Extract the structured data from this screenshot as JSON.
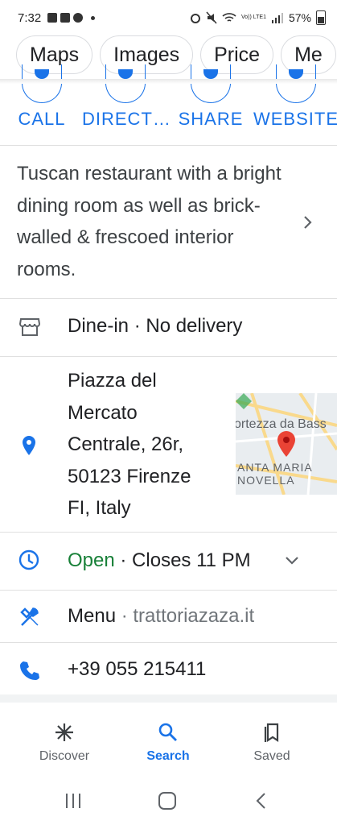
{
  "status": {
    "time": "7:32",
    "network": "Vo)) LTE1",
    "battery": "57%"
  },
  "chips": [
    "Maps",
    "Images",
    "Price",
    "Me"
  ],
  "actions": [
    {
      "label": "CALL"
    },
    {
      "label": "DIRECT…"
    },
    {
      "label": "SHARE"
    },
    {
      "label": "WEBSITE"
    }
  ],
  "description": "Tuscan restaurant with a bright dining room as well as brick-walled & frescoed interior rooms.",
  "service": {
    "text": "Dine-in · No delivery"
  },
  "address": {
    "line1": "Piazza del",
    "line2": "Mercato",
    "line3": "Centrale, 26r,",
    "line4": "50123 Firenze",
    "line5": "FI, Italy",
    "map_label_1": "ortezza da Bass",
    "map_label_2a": "ANTA MARIA",
    "map_label_2b": "NOVELLA"
  },
  "hours": {
    "status": "Open",
    "closes": "· Closes 11 PM"
  },
  "menu": {
    "label": "Menu",
    "separator": "·",
    "site": "trattoriazaza.it"
  },
  "phone": {
    "number": "+39 055 215411"
  },
  "bottom_nav": {
    "discover": "Discover",
    "search": "Search",
    "saved": "Saved"
  },
  "colors": {
    "accent": "#1a73e8",
    "open_green": "#188038",
    "map_pin": "#ea4335"
  }
}
